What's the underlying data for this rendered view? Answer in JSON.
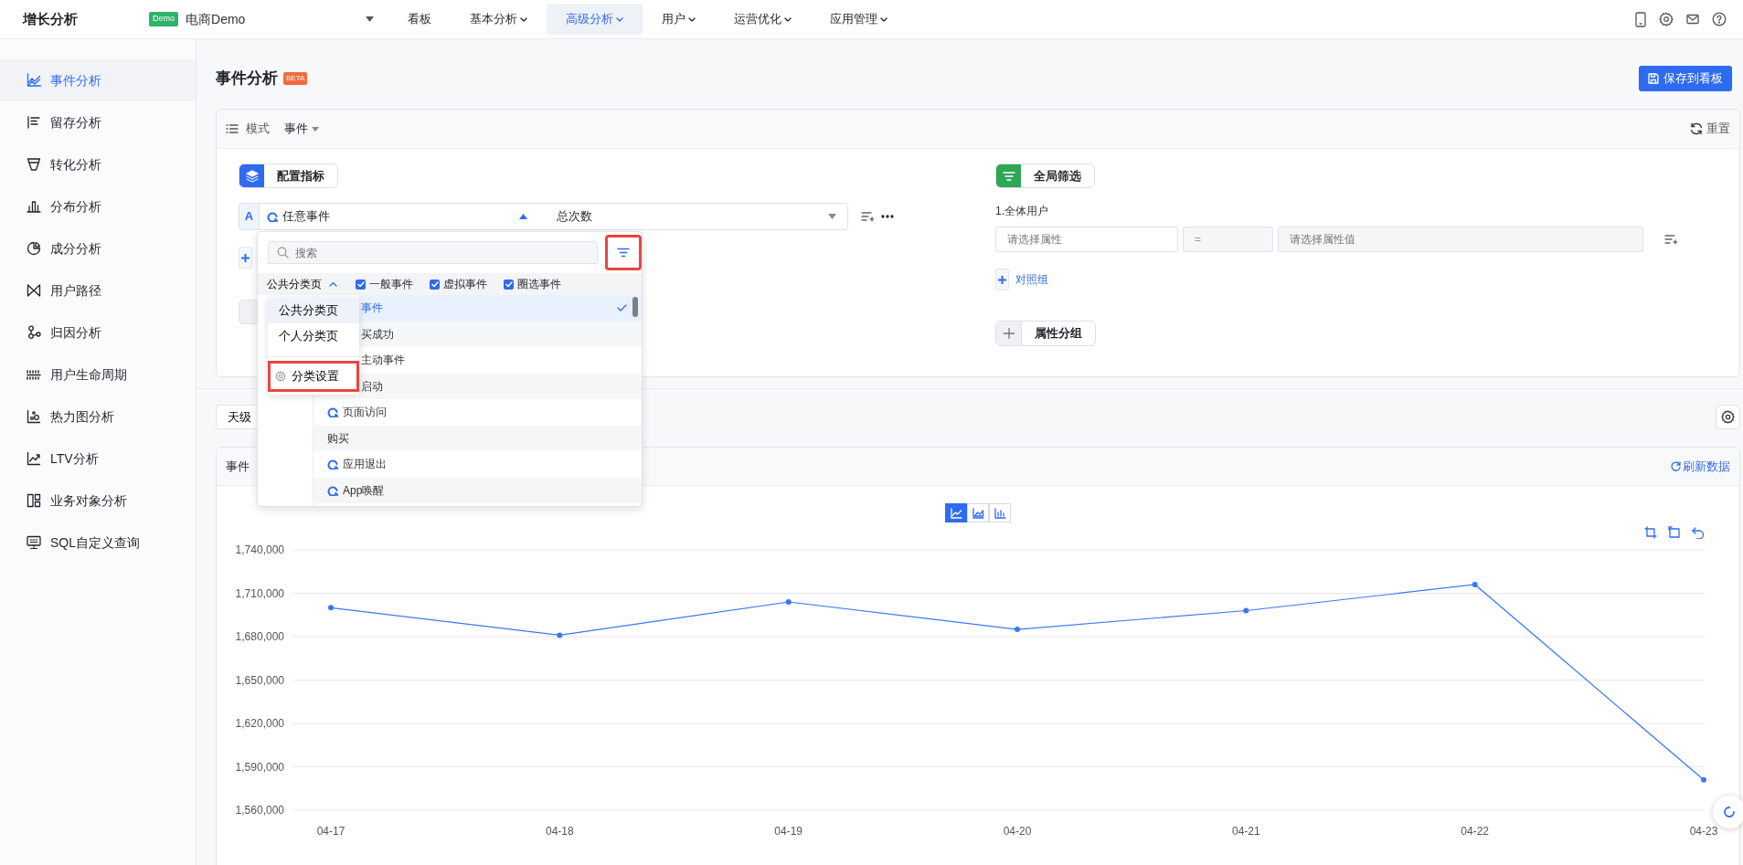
{
  "topbar": {
    "title": "增长分析",
    "project": {
      "badge": "Demo",
      "name": "电商Demo"
    },
    "nav": [
      {
        "label": "看板",
        "has_menu": false,
        "selected": false
      },
      {
        "label": "基本分析",
        "has_menu": true,
        "selected": false
      },
      {
        "label": "高级分析",
        "has_menu": true,
        "selected": true
      },
      {
        "label": "用户",
        "has_menu": true,
        "selected": false
      },
      {
        "label": "运营优化",
        "has_menu": true,
        "selected": false
      },
      {
        "label": "应用管理",
        "has_menu": true,
        "selected": false
      }
    ]
  },
  "sidebar": {
    "items": [
      {
        "label": "事件分析",
        "selected": true
      },
      {
        "label": "留存分析",
        "selected": false
      },
      {
        "label": "转化分析",
        "selected": false
      },
      {
        "label": "分布分析",
        "selected": false
      },
      {
        "label": "成分分析",
        "selected": false
      },
      {
        "label": "用户路径",
        "selected": false
      },
      {
        "label": "归因分析",
        "selected": false
      },
      {
        "label": "用户生命周期",
        "selected": false
      },
      {
        "label": "热力图分析",
        "selected": false
      },
      {
        "label": "LTV分析",
        "selected": false
      },
      {
        "label": "业务对象分析",
        "selected": false
      },
      {
        "label": "SQL自定义查询",
        "selected": false
      }
    ]
  },
  "page": {
    "title": "事件分析",
    "badge": "BETA",
    "save_button": "保存到看板"
  },
  "config": {
    "mode_label": "模式",
    "mode_value": "事件",
    "reset": "重置",
    "metrics_button": "配置指标",
    "metric": {
      "letter": "A",
      "event": "任意事件",
      "measure": "总次数"
    },
    "filter_button": "全局筛选",
    "group_label": "1.全体用户",
    "filter_row": {
      "property_placeholder": "请选择属性",
      "operator": "=",
      "value_placeholder": "请选择属性值"
    },
    "compare": "对照组",
    "group_by": "属性分组"
  },
  "toolbar": {
    "granularity": "天级"
  },
  "chart_card": {
    "title": "事件",
    "refresh": "刷新数据",
    "chart_types": [
      {
        "selected": true
      },
      {
        "selected": false
      },
      {
        "selected": false
      }
    ],
    "chart_data": {
      "type": "line",
      "categories": [
        "04-17",
        "04-18",
        "04-19",
        "04-20",
        "04-21",
        "04-22",
        "04-23"
      ],
      "grid": true,
      "series": [
        {
          "color": "#3a78f2",
          "marker": true,
          "values": [
            1700000,
            1681000,
            1704000,
            1685000,
            1698000,
            1716000,
            1581000
          ]
        }
      ],
      "ylim": [
        1560000,
        1740000
      ],
      "yticks": [
        {
          "value": 1560000,
          "label": "1,560,000"
        },
        {
          "value": 1590000,
          "label": "1,590,000"
        },
        {
          "value": 1620000,
          "label": "1,620,000"
        },
        {
          "value": 1650000,
          "label": "1,650,000"
        },
        {
          "value": 1680000,
          "label": "1,680,000"
        },
        {
          "value": 1710000,
          "label": "1,710,000"
        },
        {
          "value": 1740000,
          "label": "1,740,000"
        }
      ]
    }
  },
  "event_dropdown": {
    "search_placeholder": "搜索",
    "filter_highlighted": true,
    "category_tab": "公共分类页",
    "checks": [
      {
        "label": "一般事件",
        "checked": true
      },
      {
        "label": "虚拟事件",
        "checked": true
      },
      {
        "label": "圈选事件",
        "checked": true
      }
    ],
    "items": [
      {
        "label": "事件",
        "kind": "covered",
        "selected": true
      },
      {
        "label": "买成功",
        "kind": "covered",
        "selected": false
      },
      {
        "label": "主动事件",
        "kind": "covered",
        "selected": false
      },
      {
        "label": "启动",
        "kind": "covered",
        "selected": false
      },
      {
        "label": "页面访问",
        "kind": "event",
        "selected": false
      },
      {
        "label": "购买",
        "kind": "group",
        "selected": false
      },
      {
        "label": "应用退出",
        "kind": "event",
        "selected": false
      },
      {
        "label": "App唤醒",
        "kind": "event",
        "selected": false
      }
    ],
    "category_menu": [
      {
        "label": "公共分类页",
        "kind": "option",
        "selected": true,
        "highlighted": false
      },
      {
        "label": "个人分类页",
        "kind": "option",
        "selected": false,
        "highlighted": false
      },
      {
        "label": "分类设置",
        "kind": "settings",
        "selected": false,
        "highlighted": true
      }
    ]
  }
}
